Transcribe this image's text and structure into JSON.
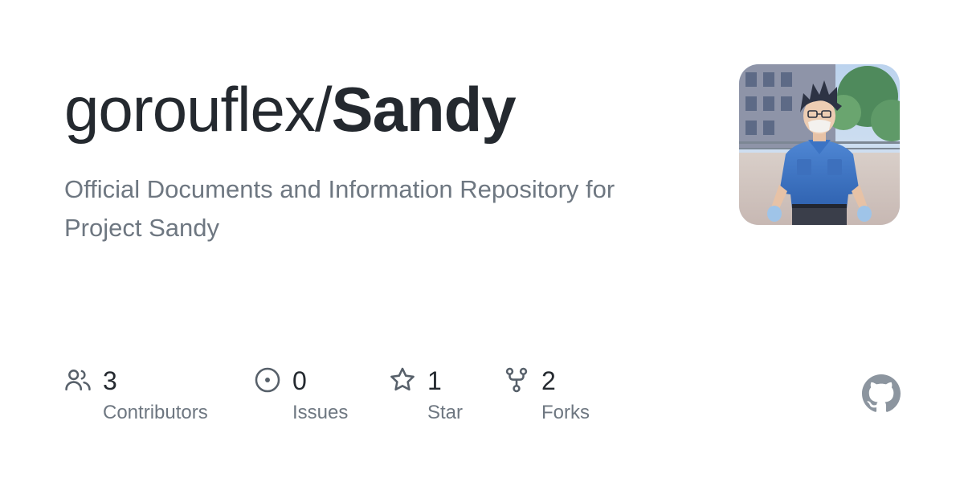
{
  "repo": {
    "owner": "gorouflex",
    "separator": "/",
    "name": "Sandy",
    "description": "Official Documents and Information Repository for Project Sandy"
  },
  "avatar": {
    "icon": "repo-owner-avatar"
  },
  "stats": [
    {
      "count": "3",
      "label": "Contributors",
      "icon": "people-icon"
    },
    {
      "count": "0",
      "label": "Issues",
      "icon": "issue-opened-icon"
    },
    {
      "count": "1",
      "label": "Star",
      "icon": "star-icon"
    },
    {
      "count": "2",
      "label": "Forks",
      "icon": "repo-forked-icon"
    }
  ],
  "footer": {
    "logo_icon": "github-mark-icon"
  },
  "colors": {
    "title": "#24292f",
    "muted": "#6e7781",
    "icon": "#57606a",
    "logo": "#8c959f"
  }
}
